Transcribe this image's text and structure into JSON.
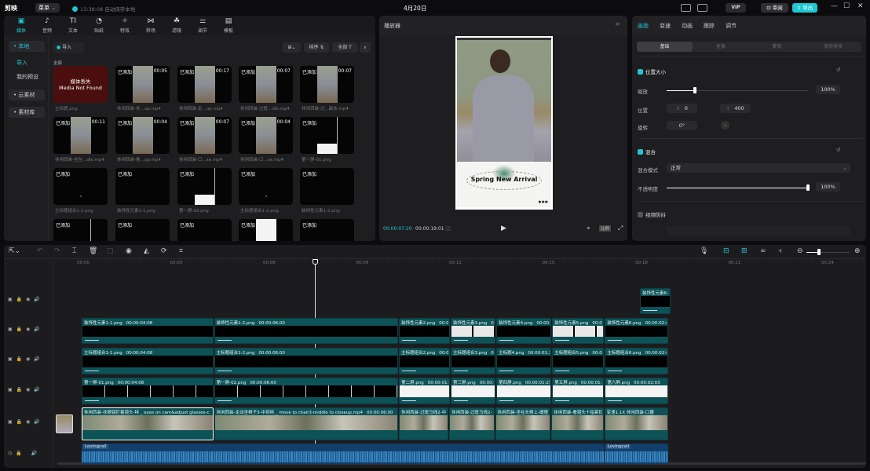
{
  "titlebar": {
    "app_name": "剪映",
    "menu_label": "菜单",
    "autosave": "13:38:08 自动保存本地",
    "date": "4月20日",
    "vip_label": "VIP",
    "review_label": "审阅",
    "export_label": "导出"
  },
  "media": {
    "tabs": [
      {
        "icon": "media-icon",
        "label": "媒体",
        "glyph": "▣"
      },
      {
        "icon": "audio-icon",
        "label": "音频",
        "glyph": "♪"
      },
      {
        "icon": "text-icon",
        "label": "文本",
        "glyph": "TI"
      },
      {
        "icon": "sticker-icon",
        "label": "贴纸",
        "glyph": "◔"
      },
      {
        "icon": "effects-icon",
        "label": "特效",
        "glyph": "✧"
      },
      {
        "icon": "transition-icon",
        "label": "转场",
        "glyph": "⋈"
      },
      {
        "icon": "filter-icon",
        "label": "滤镜",
        "glyph": "☘"
      },
      {
        "icon": "adjust-icon",
        "label": "调节",
        "glyph": "⚌"
      },
      {
        "icon": "template-icon",
        "label": "模板",
        "glyph": "▤"
      }
    ],
    "sidebar": [
      {
        "label": "• 本地",
        "active": true
      },
      {
        "label": "导入",
        "sub": true
      },
      {
        "label": "我的预设",
        "sub": true
      },
      {
        "label": "• 云素材"
      },
      {
        "label": "• 素材库"
      }
    ],
    "import_label": "导入",
    "sort_label": "排序",
    "filter_label": "全部",
    "section_label": "全部",
    "missing": {
      "line1": "媒体丢失",
      "line2": "Media Not Found"
    },
    "items": [
      {
        "name": "主标题.png",
        "missing": true
      },
      {
        "name": "休闲西装-扶...up.mp4",
        "added": "已添加",
        "duration": "00:05",
        "thumb": "photo"
      },
      {
        "name": "休闲西装-走...up.mp4",
        "added": "已添加",
        "duration": "00:17",
        "thumb": "photo"
      },
      {
        "name": "休闲西装-过斑...dle.mp4",
        "added": "已添加",
        "duration": "00:07",
        "thumb": "photo"
      },
      {
        "name": "休闲西装-过...副本.mp4",
        "added": "已添加",
        "duration": "00:07",
        "thumb": "photo"
      },
      {
        "name": "休闲西装-坐在...dle.mp4",
        "added": "已添加",
        "duration": "00:11",
        "thumb": "photo"
      },
      {
        "name": "休闲西装-看...up.mp4",
        "added": "已添加",
        "duration": "00:04",
        "thumb": "photo"
      },
      {
        "name": "休闲西装-口...se.mp4",
        "added": "已添加",
        "duration": "00:07",
        "thumb": "photo"
      },
      {
        "name": "休闲西装-口...se.mp4",
        "added": "已添加",
        "duration": "00:04",
        "thumb": "photo"
      },
      {
        "name": "第一屏-01.png",
        "added": "已添加",
        "thumb": "white"
      },
      {
        "name": "主标题组合1-1.png",
        "added": "已添加",
        "thumb": "dark"
      },
      {
        "name": "装饰性元素1-1.png",
        "added": "已添加",
        "thumb": "dark"
      },
      {
        "name": "第一屏-02.png",
        "added": "已添加",
        "thumb": "white"
      },
      {
        "name": "主标题组合1-2.png",
        "added": "已添加",
        "thumb": "dark"
      },
      {
        "name": "装饰性元素1-2.png",
        "added": "已添加",
        "thumb": "dark"
      },
      {
        "name": "",
        "added": "已添加",
        "thumb": "white"
      },
      {
        "name": "",
        "added": "已添加",
        "thumb": "dark"
      },
      {
        "name": "",
        "added": "已添加",
        "thumb": "dark"
      },
      {
        "name": "",
        "added": "已添加",
        "thumb": "whitebig"
      },
      {
        "name": "",
        "added": "已添加",
        "thumb": "dark"
      }
    ]
  },
  "player": {
    "title": "播放器",
    "preview_text": "Spring New Arrival",
    "current_time": "00:00:07:20",
    "total_time": "00:00:19:01",
    "ratio_label": "比例"
  },
  "inspector": {
    "tabs": [
      "画面",
      "变速",
      "动画",
      "跟踪",
      "调节"
    ],
    "segments": [
      "基础",
      "抠像",
      "蒙版",
      "美颜美体"
    ],
    "position_size": {
      "title": "位置大小",
      "scale_label": "缩放",
      "scale_value": "100%",
      "scale_fraction": 0.2,
      "position_label": "位置",
      "x": "0",
      "y": "400",
      "rotate_label": "旋转",
      "rotate_value": "0°"
    },
    "blend": {
      "title": "混合",
      "mode_label": "混合模式",
      "mode_value": "正常",
      "opacity_label": "不透明度",
      "opacity_value": "100%",
      "opacity_fraction": 1.0
    },
    "stabilize": {
      "title": "视频防抖"
    }
  },
  "timeline": {
    "ruler": [
      "00:00",
      "00:03",
      "00:06",
      "00:09",
      "00:12",
      "00:15",
      "00:18",
      "00:21",
      "00:24"
    ],
    "playhead_seconds": 7.67,
    "tracks": [
      {
        "type": "image",
        "clips": [
          {
            "name": "装饰性元素6-",
            "start": 18.0,
            "end": 19.0
          }
        ]
      },
      {
        "type": "image",
        "clips": [
          {
            "name": "装饰性元素1-1.png",
            "duration": "00:00:04:08",
            "start": 0,
            "end": 4.27
          },
          {
            "name": "装饰性元素1-2.png",
            "duration": "00:00:06:00",
            "start": 4.27,
            "end": 10.23
          },
          {
            "name": "装饰性元素2.png",
            "duration": "00:00:01",
            "start": 10.23,
            "end": 11.9
          },
          {
            "name": "装饰性元素3.png",
            "duration": "00:00",
            "start": 11.9,
            "end": 13.37,
            "pattern": true
          },
          {
            "name": "装饰性元素4.png",
            "duration": "00:00:0",
            "start": 13.37,
            "end": 15.17
          },
          {
            "name": "装饰性元素5.png",
            "duration": "00:00",
            "start": 15.17,
            "end": 16.87,
            "pattern": true
          },
          {
            "name": "装饰性元素6.png",
            "duration": "00:00:02:03",
            "start": 16.87,
            "end": 18.93
          }
        ]
      },
      {
        "type": "image",
        "clips": [
          {
            "name": "主标题组合1-1.png",
            "duration": "00:00:04:08",
            "start": 0,
            "end": 4.27
          },
          {
            "name": "主标题组合1-2.png",
            "duration": "00:00:06:00",
            "start": 4.27,
            "end": 10.23
          },
          {
            "name": "主标题组合2.png",
            "duration": "00:00",
            "start": 10.23,
            "end": 11.9
          },
          {
            "name": "主标题组合3.png",
            "duration": "00",
            "start": 11.9,
            "end": 13.37
          },
          {
            "name": "主标题4.png",
            "duration": "00:00:01:25",
            "start": 13.37,
            "end": 15.17
          },
          {
            "name": "主标题组合5.png",
            "duration": "00:00",
            "start": 15.17,
            "end": 16.87
          },
          {
            "name": "主标题组合6.png",
            "duration": "00:00:02:03",
            "start": 16.87,
            "end": 18.93
          }
        ]
      },
      {
        "type": "white",
        "clips": [
          {
            "name": "第一屏-01.png",
            "duration": "00:00:04:08",
            "start": 0,
            "end": 4.27,
            "dark": true
          },
          {
            "name": "第一屏-02.png",
            "duration": "00:00:06:00",
            "start": 4.27,
            "end": 10.23,
            "dark": true
          },
          {
            "name": "第二屏.png",
            "duration": "00:00:01:2",
            "start": 10.23,
            "end": 11.9
          },
          {
            "name": "第三屏.png",
            "duration": "00:00:0",
            "start": 11.9,
            "end": 13.37
          },
          {
            "name": "第四屏.png",
            "duration": "00:00:01:25",
            "start": 13.37,
            "end": 15.17
          },
          {
            "name": "第五屏.png",
            "duration": "00:00:01:2",
            "start": 15.17,
            "end": 16.87
          },
          {
            "name": "第六屏.png",
            "duration": "00:00:02:03",
            "start": 16.87,
            "end": 18.93
          }
        ]
      },
      {
        "type": "video",
        "clips": [
          {
            "name": "休闲西装-扶眼镜盯着镜头-特 _ eyes on cam&adjust glasses-c",
            "start": 0,
            "end": 4.27,
            "selected": true
          },
          {
            "name": "休闲西装-走动坐椅子3-中到特 _ move to chair3-middle to closeup.mp4",
            "duration": "00:00:06:00",
            "start": 4.27,
            "end": 10.23
          },
          {
            "name": "休闲西装-过斑马线2-中",
            "start": 10.23,
            "end": 11.85
          },
          {
            "name": "休闲西装-过斑马线2-",
            "start": 11.85,
            "end": 13.33
          },
          {
            "name": "休闲西装-坐在长椅上-缓慢",
            "start": 13.33,
            "end": 15.15
          },
          {
            "name": "休闲西装-看镜头十指紧扣",
            "start": 15.15,
            "end": 16.85
          },
          {
            "name": "变速1.1X  休闲西装-口播",
            "start": 16.85,
            "end": 18.93
          }
        ]
      },
      {
        "type": "audio",
        "clips": [
          {
            "name": "Lovingcall",
            "start": 0,
            "end": 16.85
          },
          {
            "name": "Lovingcall",
            "start": 16.85,
            "end": 18.93
          }
        ]
      }
    ]
  },
  "colors": {
    "accent": "#1fc7d4",
    "clip": "#0d5257",
    "audio": "#123f6b",
    "missing": "#4a0e0e"
  }
}
